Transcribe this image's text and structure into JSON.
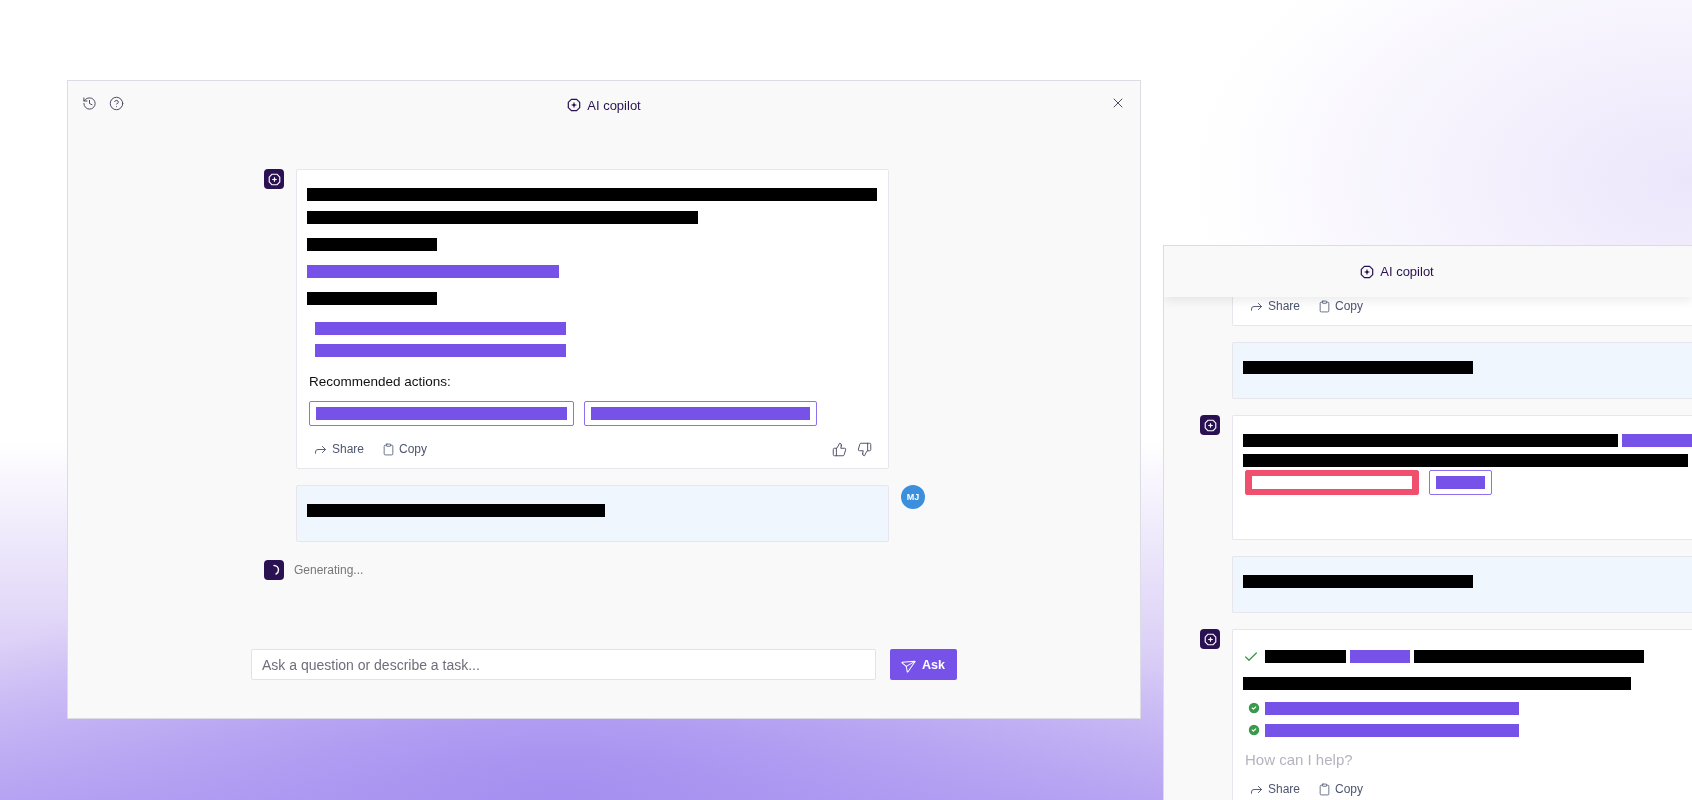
{
  "main_window": {
    "title": "AI copilot",
    "messages": [
      {
        "kind": "assistant",
        "blocks": [
          {
            "kind": "line",
            "segments": [
              {
                "color": "#000000"
              }
            ]
          },
          {
            "kind": "line",
            "segments": [
              {
                "color": "#000000"
              }
            ]
          },
          {
            "kind": "line",
            "segments": [
              {
                "color": "#000000"
              }
            ]
          },
          {
            "kind": "line",
            "segments": [
              {
                "color": "#7752e8"
              }
            ]
          },
          {
            "kind": "line",
            "segments": [
              {
                "color": "#000000"
              }
            ]
          },
          {
            "kind": "list",
            "segments": [
              {
                "color": "#7752e8"
              },
              {
                "color": "#7752e8"
              }
            ]
          },
          {
            "kind": "heading",
            "text": "Recommended actions:"
          },
          {
            "kind": "actions",
            "segments": [
              {
                "kind": "outlined",
                "color": "#7752e8"
              },
              {
                "kind": "outlined",
                "color": "#7752e8"
              }
            ]
          }
        ],
        "share": "Share",
        "copy": "Copy",
        "feedback": true
      },
      {
        "kind": "user",
        "avatar": "MJ",
        "blocks": [
          {
            "kind": "line",
            "segments": [
              {
                "color": "#000000"
              }
            ]
          }
        ]
      }
    ],
    "status": "Generating...",
    "input": {
      "placeholder": "Ask a question or describe a task..."
    },
    "ask_button": "Ask"
  },
  "side_panel": {
    "title": "AI copilot",
    "messages": [
      {
        "kind": "assistant",
        "partial": true,
        "share": "Share",
        "copy": "Copy"
      },
      {
        "kind": "user",
        "blocks": [
          {
            "kind": "line",
            "segments": [
              {
                "color": "#000000"
              }
            ]
          }
        ]
      },
      {
        "kind": "assistant",
        "blocks": [
          {
            "kind": "line",
            "segments": [
              {
                "color": "#000000"
              },
              {
                "color": "#7752e8"
              }
            ]
          },
          {
            "kind": "line",
            "segments": [
              {
                "color": "#000000"
              }
            ]
          },
          {
            "kind": "actions",
            "segments": [
              {
                "kind": "filled",
                "color": "#f0506e"
              },
              {
                "kind": "outlined",
                "color": "#7752e8"
              }
            ]
          }
        ]
      },
      {
        "kind": "user",
        "blocks": [
          {
            "kind": "line",
            "segments": [
              {
                "color": "#000000"
              }
            ]
          }
        ]
      },
      {
        "kind": "assistant",
        "blocks": [
          {
            "kind": "checked_line",
            "segments": [
              {
                "color": "#000000"
              },
              {
                "color": "#7752e8"
              },
              {
                "color": "#000000"
              }
            ]
          },
          {
            "kind": "line",
            "segments": [
              {
                "color": "#000000"
              }
            ]
          },
          {
            "kind": "check_list",
            "segments": [
              {
                "color": "#7752e8"
              },
              {
                "color": "#7752e8"
              }
            ]
          }
        ],
        "hint": "How can I help?",
        "share": "Share",
        "copy": "Copy"
      }
    ]
  }
}
